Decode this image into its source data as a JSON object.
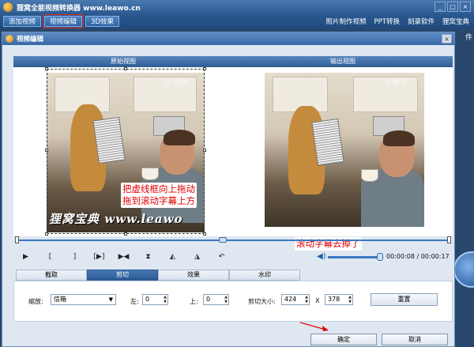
{
  "app": {
    "title": "狸窝全能视频转换器 www.leawo.cn",
    "window_buttons": [
      "_",
      "□",
      "×"
    ]
  },
  "toolbar": {
    "buttons": [
      "添加视频",
      "视频编辑",
      "3D效果"
    ],
    "right_links": [
      "照片制作视频",
      "PPT转换",
      "刻录软件",
      "狸窝宝典"
    ]
  },
  "background": {
    "right_text": "件"
  },
  "dialog": {
    "title": "视频编辑",
    "close": "×",
    "view_headers": [
      "原始视图",
      "输出视图"
    ],
    "watermark_icon": "◎ 刷沙",
    "watermark_strip": "狸窝宝典 www.leawo",
    "note_left": "把虚线框向上拖动\n拖到滚动字幕上方",
    "note_right": "滚动字幕去掉了",
    "controls": [
      "▶",
      "[",
      "]",
      "[▶]",
      "▶◀",
      "⧗",
      "◭",
      "◮",
      "↶"
    ],
    "timecode": "00:00:08 / 00:00:17",
    "tabs": [
      "截取",
      "剪切",
      "效果",
      "水印"
    ],
    "active_tab": "剪切",
    "settings": {
      "zoom_label": "缩放:",
      "zoom_value": "信箱",
      "left_label": "左:",
      "left_value": "0",
      "top_label": "上:",
      "top_value": "0",
      "size_label": "剪切大小:",
      "width_value": "424",
      "x_sep": "X",
      "height_value": "378",
      "reset": "重置"
    },
    "ok": "确定",
    "cancel": "取消"
  },
  "colors": {
    "accent": "#2b5a93",
    "note_text": "#e00000",
    "highlight": "#e0281e"
  }
}
